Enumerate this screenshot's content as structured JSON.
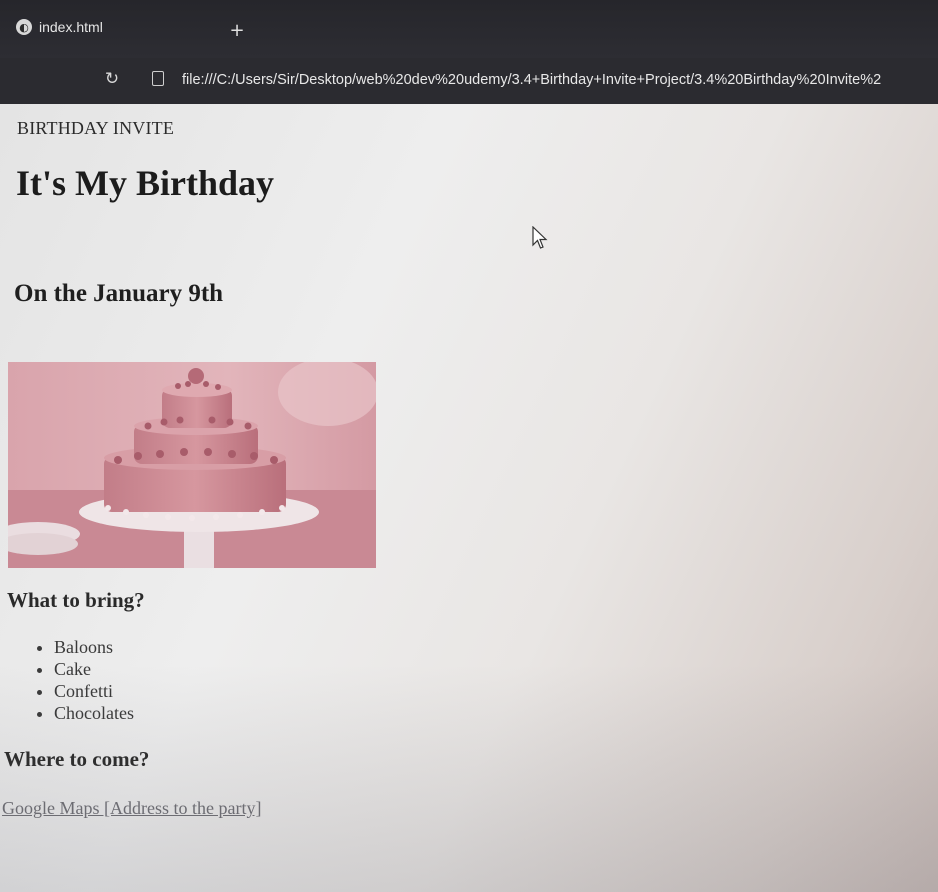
{
  "browser": {
    "tab": {
      "title": "index.html",
      "icon": "globe-icon"
    },
    "new_tab_label": "+",
    "reload_icon": "reload-icon",
    "url": "file:///C:/Users/Sir/Desktop/web%20dev%20udemy/3.4+Birthday+Invite+Project/3.4%20Birthday%20Invite%2"
  },
  "page": {
    "document_title": "BIRTHDAY INVITE",
    "heading": "It's My Birthday",
    "date_heading": "On the January 9th",
    "image": {
      "subject": "three-tier pink birthday cake on a cake stand"
    },
    "bring": {
      "heading": "What to bring?",
      "items": [
        "Baloons",
        "Cake",
        "Confetti",
        "Chocolates"
      ]
    },
    "where": {
      "heading": "Where to come?",
      "link_text": "Google Maps [Address to the party]"
    }
  },
  "colors": {
    "chrome_background": "#2b2b30",
    "page_background": "#eeeeee",
    "cake_pink": "#cf8c96"
  }
}
